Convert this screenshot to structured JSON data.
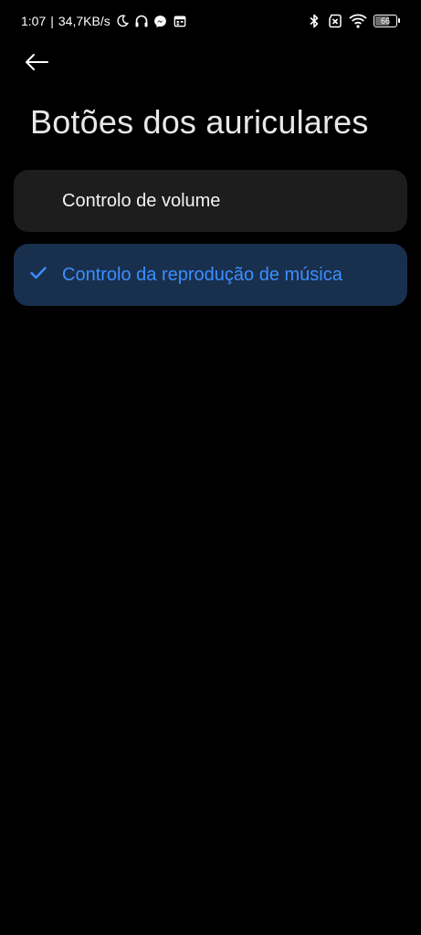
{
  "status_bar": {
    "time": "1:07",
    "separator": "|",
    "network_speed": "34,7KB/s",
    "icons_left": [
      "moon-icon",
      "headphones-icon",
      "messenger-icon",
      "calendar-icon"
    ],
    "icons_right": [
      "bluetooth-icon",
      "sim-no-signal-icon",
      "wifi-icon"
    ],
    "battery_level": "66",
    "battery_fraction": 0.66
  },
  "header": {
    "back_icon": "arrow-left-icon",
    "title": "Botões dos auriculares"
  },
  "options": [
    {
      "label": "Controlo de volume",
      "selected": false
    },
    {
      "label": "Controlo da reprodução de música",
      "selected": true,
      "check_icon": "checkmark-icon"
    }
  ],
  "colors": {
    "background": "#000000",
    "option_background": "#1d1d1d",
    "selected_background": "#18304e",
    "accent": "#3d8eff"
  }
}
